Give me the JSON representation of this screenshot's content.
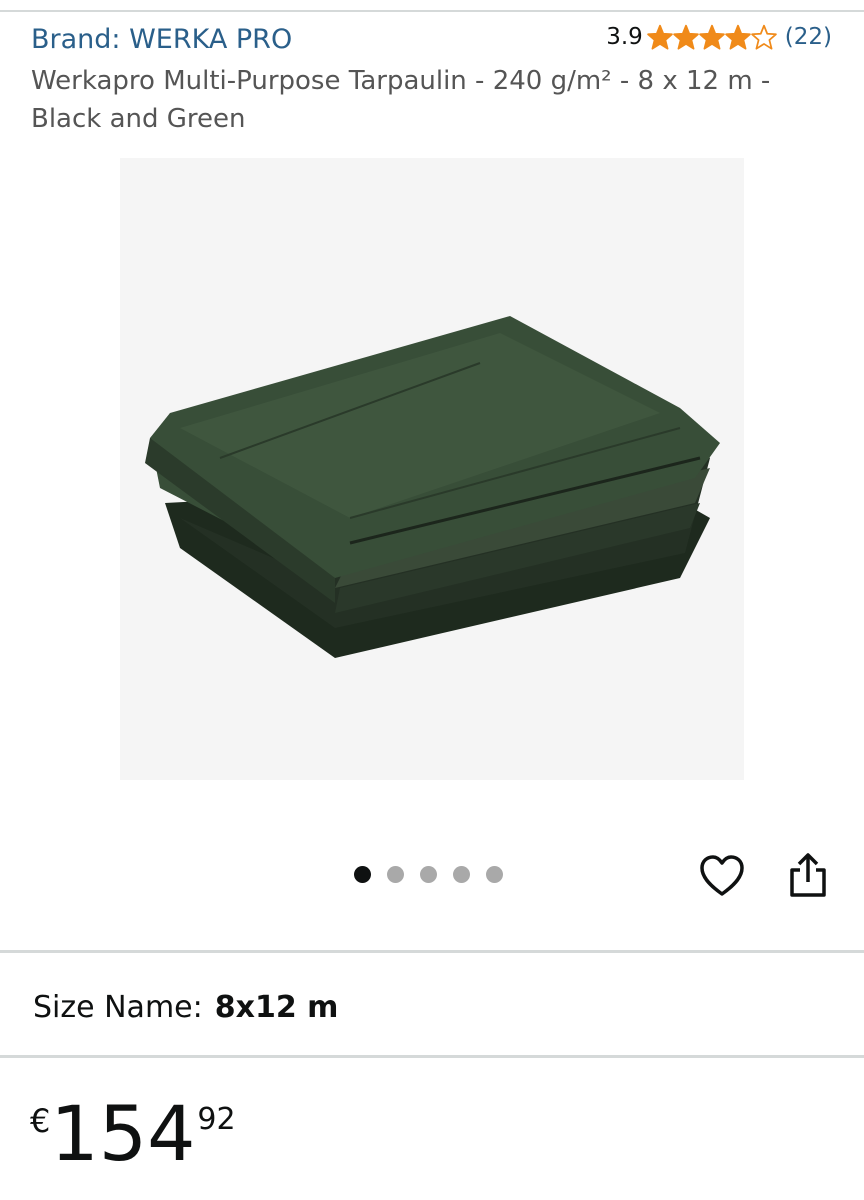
{
  "header": {
    "brand_label": "Brand: WERKA PRO",
    "rating_value": "3.9",
    "rating_stars": 3.9,
    "rating_count": "(22)",
    "star_color": "#f08a19"
  },
  "product": {
    "title": "Werkapro Multi-Purpose Tarpaulin - 240 g/m² - 8 x 12 m - Black and Green",
    "image_subject": "folded-green-tarpaulin"
  },
  "gallery": {
    "total_images": 5,
    "active_index": 0,
    "icons": [
      "heart-icon",
      "share-icon"
    ]
  },
  "variation": {
    "label": "Size Name:",
    "value": "8x12 m"
  },
  "price": {
    "symbol": "€",
    "whole": "154",
    "fraction": "92"
  },
  "colors": {
    "link": "#2a5f8a",
    "text": "#0f1111",
    "muted": "#555555",
    "divider": "#d5d9d9"
  }
}
